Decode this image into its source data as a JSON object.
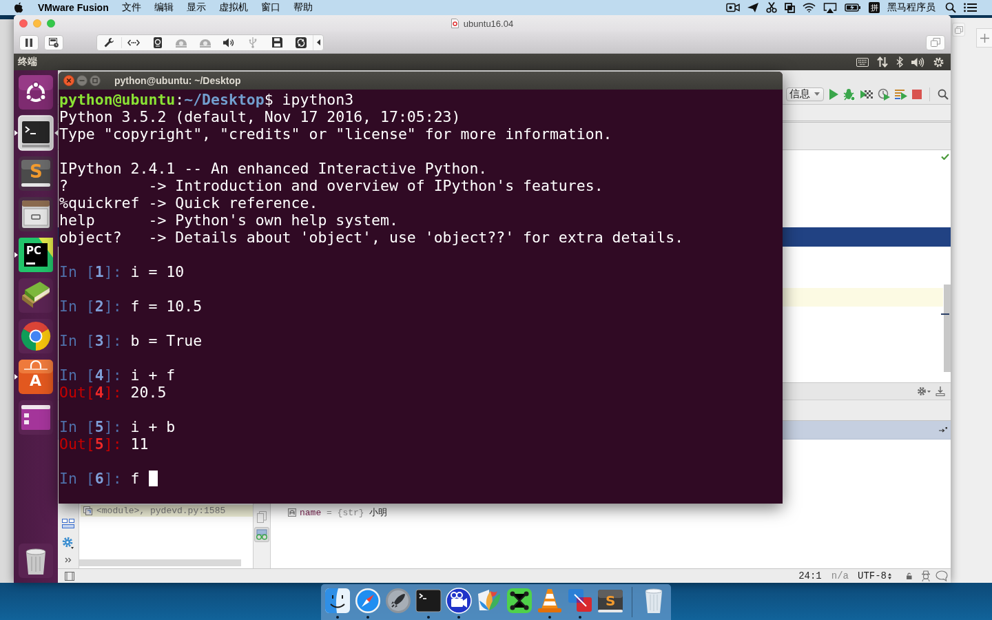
{
  "menu_bar": {
    "app_name": "VMware Fusion",
    "menus": [
      "文件",
      "编辑",
      "显示",
      "虚拟机",
      "窗口",
      "帮助"
    ],
    "input_method": "拼",
    "user_name": "黑马程序员"
  },
  "vm_window": {
    "title": "ubuntu16.04"
  },
  "ubuntu_panel": {
    "title": "终端"
  },
  "launcher": [
    {
      "kind": "dash",
      "running": false,
      "focused": false
    },
    {
      "kind": "terminal",
      "running": true,
      "focused": true
    },
    {
      "kind": "editor",
      "label": "S",
      "running": false,
      "focused": false
    },
    {
      "kind": "files",
      "running": false,
      "focused": false
    },
    {
      "kind": "ide",
      "label": "PC",
      "running": true,
      "focused": false
    },
    {
      "kind": "books",
      "running": false,
      "focused": false
    },
    {
      "kind": "browser",
      "running": false,
      "focused": false
    },
    {
      "kind": "store",
      "label": "A",
      "running": true,
      "focused": false
    },
    {
      "kind": "window",
      "running": false,
      "focused": false
    },
    {
      "kind": "trash",
      "running": false,
      "focused": false
    }
  ],
  "terminal": {
    "title": "python@ubuntu: ~/Desktop",
    "cursor": true,
    "blocks": [
      {
        "lines": [
          {
            "segments": [
              {
                "text": "python@ubuntu",
                "kind": "user"
              },
              {
                "text": ":",
                "kind": "plain"
              },
              {
                "text": "~/Desktop",
                "kind": "path"
              },
              {
                "text": "$ ipython3",
                "kind": "plain"
              }
            ]
          },
          {
            "segments": [
              {
                "text": "Python 3.5.2 (default, Nov 17 2016, 17:05:23)",
                "kind": "plain"
              }
            ]
          },
          {
            "segments": [
              {
                "text": "Type \"copyright\", \"credits\" or \"license\" for more information.",
                "kind": "plain"
              }
            ]
          }
        ]
      },
      {
        "lines": [
          {
            "segments": [
              {
                "text": "IPython 2.4.1 -- An enhanced Interactive Python.",
                "kind": "plain"
              }
            ]
          },
          {
            "segments": [
              {
                "text": "?         -> Introduction and overview of IPython's features.",
                "kind": "plain"
              }
            ]
          },
          {
            "segments": [
              {
                "text": "%quickref -> Quick reference.",
                "kind": "plain"
              }
            ]
          },
          {
            "segments": [
              {
                "text": "help      -> Python's own help system.",
                "kind": "plain"
              }
            ]
          },
          {
            "segments": [
              {
                "text": "object?   -> Details about 'object', use 'object??' for extra details.",
                "kind": "plain"
              }
            ]
          }
        ]
      },
      {
        "lines": [
          {
            "segments": [
              {
                "text": "In [",
                "kind": "in"
              },
              {
                "text": "1",
                "kind": "in-num"
              },
              {
                "text": "]: ",
                "kind": "in"
              },
              {
                "text": "i = 10",
                "kind": "plain"
              }
            ]
          }
        ]
      },
      {
        "lines": [
          {
            "segments": [
              {
                "text": "In [",
                "kind": "in"
              },
              {
                "text": "2",
                "kind": "in-num"
              },
              {
                "text": "]: ",
                "kind": "in"
              },
              {
                "text": "f = 10.5",
                "kind": "plain"
              }
            ]
          }
        ]
      },
      {
        "lines": [
          {
            "segments": [
              {
                "text": "In [",
                "kind": "in"
              },
              {
                "text": "3",
                "kind": "in-num"
              },
              {
                "text": "]: ",
                "kind": "in"
              },
              {
                "text": "b = True",
                "kind": "plain"
              }
            ]
          }
        ]
      },
      {
        "lines": [
          {
            "segments": [
              {
                "text": "In [",
                "kind": "in"
              },
              {
                "text": "4",
                "kind": "in-num"
              },
              {
                "text": "]: ",
                "kind": "in"
              },
              {
                "text": "i + f",
                "kind": "plain"
              }
            ]
          },
          {
            "segments": [
              {
                "text": "Out[",
                "kind": "out"
              },
              {
                "text": "4",
                "kind": "out-num"
              },
              {
                "text": "]: ",
                "kind": "out"
              },
              {
                "text": "20.5",
                "kind": "plain"
              }
            ]
          }
        ]
      },
      {
        "lines": [
          {
            "segments": [
              {
                "text": "In [",
                "kind": "in"
              },
              {
                "text": "5",
                "kind": "in-num"
              },
              {
                "text": "]: ",
                "kind": "in"
              },
              {
                "text": "i + b",
                "kind": "plain"
              }
            ]
          },
          {
            "segments": [
              {
                "text": "Out[",
                "kind": "out"
              },
              {
                "text": "5",
                "kind": "out-num"
              },
              {
                "text": "]: ",
                "kind": "out"
              },
              {
                "text": "11",
                "kind": "plain"
              }
            ]
          }
        ]
      },
      {
        "lines": [
          {
            "segments": [
              {
                "text": "In [",
                "kind": "in"
              },
              {
                "text": "6",
                "kind": "in-num"
              },
              {
                "text": "]: ",
                "kind": "in"
              },
              {
                "text": "f",
                "kind": "plain"
              }
            ]
          }
        ]
      }
    ]
  },
  "pycharm": {
    "run_config": "信息",
    "frames": [
      {
        "text": "<module>, pydevd.py:1585",
        "selected": true
      }
    ],
    "variables": [
      {
        "segments": [
          {
            "text": "name",
            "kind": "name"
          },
          {
            "text": " = {str} ",
            "kind": "type"
          },
          {
            "text": "小明",
            "kind": "value"
          }
        ]
      }
    ],
    "status": {
      "position": "24:1",
      "lock_state": "n/a",
      "encoding": "UTF-8"
    }
  },
  "dock": [
    {
      "kind": "finder",
      "running": true
    },
    {
      "kind": "compass",
      "running": true
    },
    {
      "kind": "rocket",
      "running": false
    },
    {
      "kind": "terminal",
      "running": true
    },
    {
      "kind": "video",
      "running": true
    },
    {
      "kind": "leaves",
      "running": false
    },
    {
      "kind": "mindmap",
      "running": false
    },
    {
      "kind": "cone",
      "running": true
    },
    {
      "kind": "virtual",
      "running": true
    },
    {
      "kind": "editor",
      "label": "S",
      "running": false
    },
    {
      "kind": "trash",
      "running": false
    }
  ]
}
